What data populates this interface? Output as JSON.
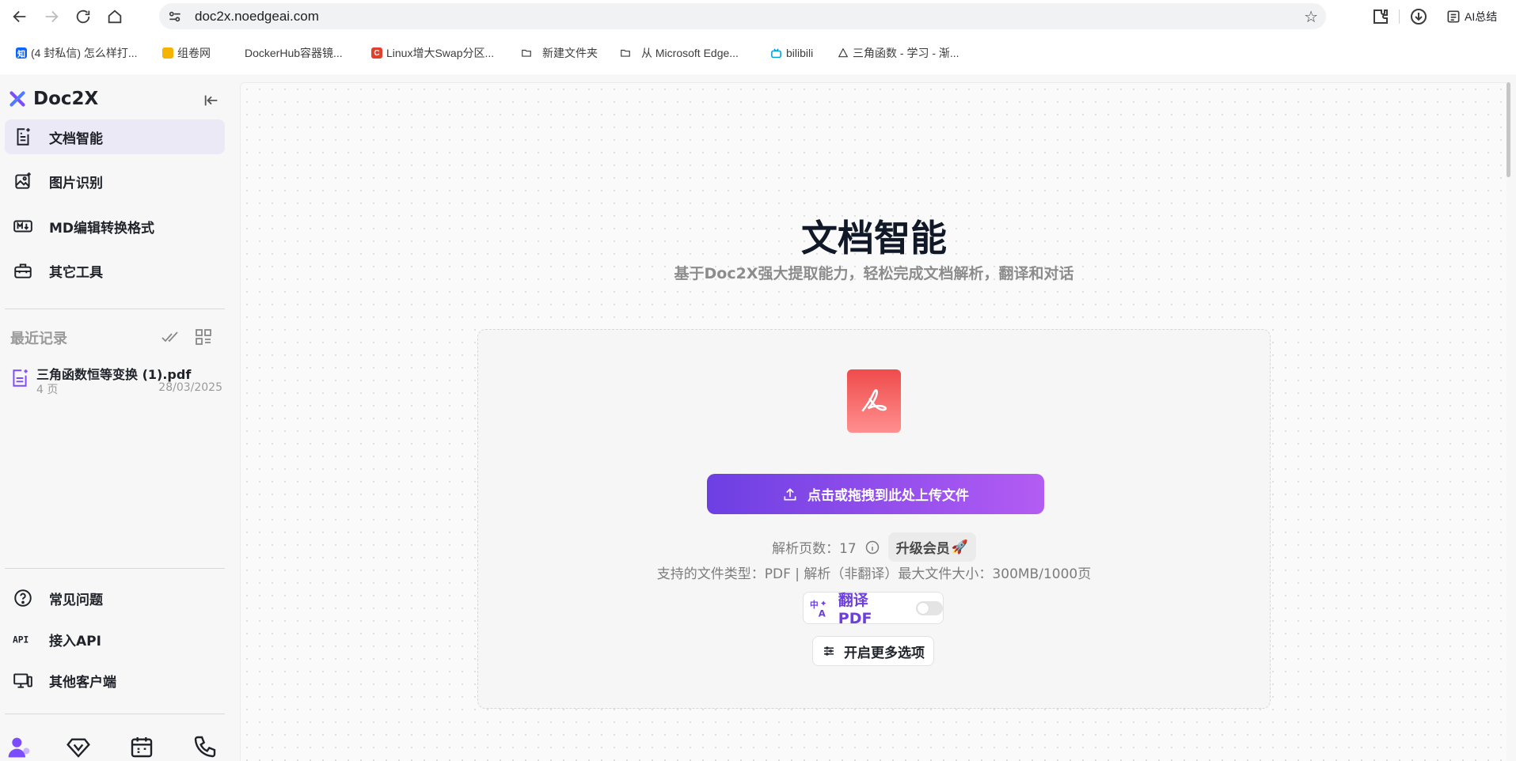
{
  "browser": {
    "url": "doc2x.noedgeai.com",
    "ai_summary_label": "AI总结",
    "bookmarks": [
      {
        "label": "(4 封私信) 怎么样打...",
        "fav": "知",
        "color": "#0a66ff"
      },
      {
        "label": "组卷网",
        "fav": "",
        "color": "#f5b400"
      },
      {
        "label": "DockerHub容器镜...",
        "fav": "",
        "color": ""
      },
      {
        "label": "Linux增大Swap分区...",
        "fav": "C",
        "color": "#e1402c"
      },
      {
        "label": "新建文件夹",
        "fav": "",
        "color": ""
      },
      {
        "label": "从 Microsoft Edge...",
        "fav": "",
        "color": ""
      },
      {
        "label": "bilibili",
        "fav": "",
        "color": "#00a1d6"
      },
      {
        "label": "三角函数 - 学习 - 渐...",
        "fav": "",
        "color": ""
      }
    ]
  },
  "sidebar": {
    "brand": "Doc2X",
    "nav": [
      {
        "label": "文档智能",
        "icon": "document-ai-icon"
      },
      {
        "label": "图片识别",
        "icon": "image-recognition-icon"
      },
      {
        "label": "MD编辑转换格式",
        "icon": "markdown-icon"
      },
      {
        "label": "其它工具",
        "icon": "toolbox-icon"
      }
    ],
    "recent_title": "最近记录",
    "recent_files": [
      {
        "name": "三角函数恒等变换 (1).pdf",
        "pages": "4 页",
        "date": "28/03/2025"
      }
    ],
    "footer_nav": [
      {
        "label": "常见问题",
        "icon": "help-circle-icon"
      },
      {
        "label": "接入API",
        "icon": "api-icon"
      },
      {
        "label": "其他客户端",
        "icon": "devices-icon"
      }
    ]
  },
  "main": {
    "title": "文档智能",
    "subtitle": "基于Doc2X强大提取能力，轻松完成文档解析，翻译和对话",
    "upload_label": "点击或拖拽到此处上传文件",
    "quota_label": "解析页数：",
    "quota_value": "17",
    "upgrade_label": "升级会员",
    "filetypes": "支持的文件类型：PDF  |  解析（非翻译）最大文件大小：300MB/1000页",
    "translate_label": "翻译 PDF",
    "translate_enabled": false,
    "more_options_label": "开启更多选项"
  },
  "colors": {
    "accent": "#6d3fe3",
    "accent_end": "#b35cf3",
    "pdf_red": "#ef4b4b"
  }
}
